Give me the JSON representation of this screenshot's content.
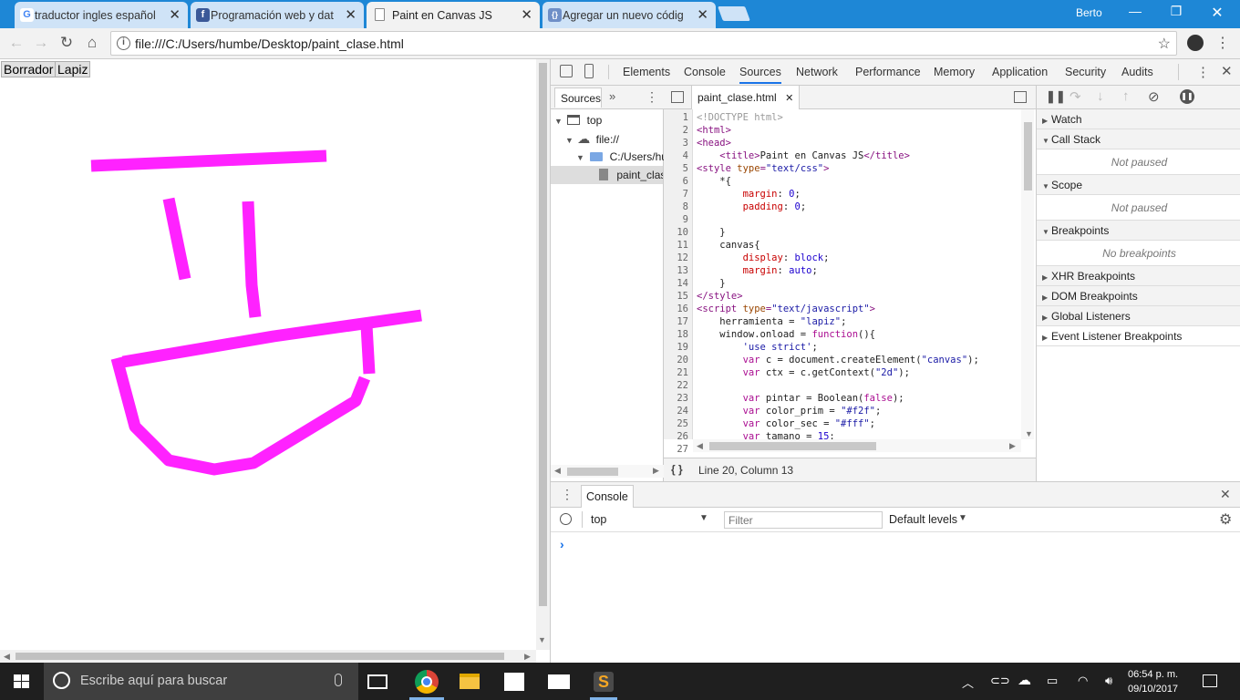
{
  "browser": {
    "tabs": [
      {
        "title": "traductor ingles español",
        "favicon": "google-icon"
      },
      {
        "title": "Programación web y dat",
        "favicon": "facebook-icon"
      },
      {
        "title": "Paint en Canvas JS",
        "favicon": "page-icon",
        "active": true
      },
      {
        "title": "Agregar un nuevo códig",
        "favicon": "code-icon"
      }
    ],
    "profile": "Berto",
    "url": "file:///C:/Users/humbe/Desktop/paint_clase.html"
  },
  "page": {
    "buttons": {
      "eraser": "Borrador",
      "pencil": "Lapiz"
    },
    "stroke_color": "#ff22ff"
  },
  "devtools": {
    "tabs": [
      "Elements",
      "Console",
      "Sources",
      "Network",
      "Performance",
      "Memory",
      "Application",
      "Security",
      "Audits"
    ],
    "selected_tab": "Sources",
    "navigator": {
      "tab": "Sources",
      "tree": [
        "top",
        "file://",
        "C:/Users/hu",
        "paint_clas"
      ]
    },
    "editor": {
      "file_tab": "paint_clase.html",
      "status": "Line 20, Column 13",
      "line_numbers": [
        "1",
        "2",
        "3",
        "4",
        "5",
        "6",
        "7",
        "8",
        "9",
        "10",
        "11",
        "12",
        "13",
        "14",
        "15",
        "16",
        "17",
        "18",
        "19",
        "20",
        "21",
        "22",
        "23",
        "24",
        "25",
        "26",
        "27"
      ]
    },
    "debugger": {
      "panes": [
        {
          "title": "Watch",
          "expanded": false
        },
        {
          "title": "Call Stack",
          "expanded": true,
          "body": "Not paused"
        },
        {
          "title": "Scope",
          "expanded": true,
          "body": "Not paused"
        },
        {
          "title": "Breakpoints",
          "expanded": true,
          "body": "No breakpoints"
        },
        {
          "title": "XHR Breakpoints",
          "expanded": false
        },
        {
          "title": "DOM Breakpoints",
          "expanded": false
        },
        {
          "title": "Global Listeners",
          "expanded": false
        },
        {
          "title": "Event Listener Breakpoints",
          "expanded": false
        }
      ]
    },
    "console": {
      "tab": "Console",
      "context": "top",
      "filter_placeholder": "Filter",
      "levels": "Default levels",
      "prompt": "›"
    }
  },
  "taskbar": {
    "search_placeholder": "Escribe aquí para buscar",
    "time": "06:54 p. m.",
    "date": "09/10/2017"
  }
}
